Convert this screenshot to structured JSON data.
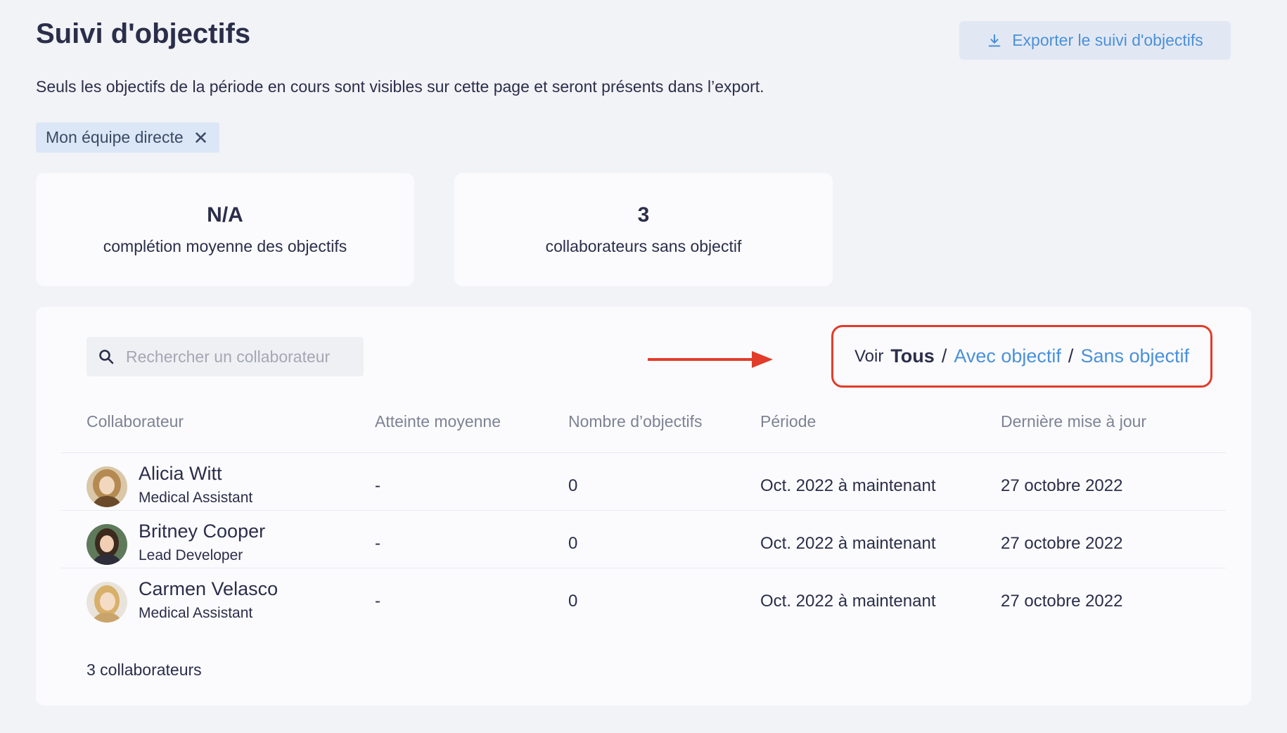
{
  "header": {
    "title": "Suivi d'objectifs",
    "export_label": "Exporter le suivi d'objectifs",
    "subtitle": "Seuls les objectifs de la période en cours sont visibles sur cette page et seront présents dans l’export."
  },
  "filter_chip": {
    "label": "Mon équipe directe",
    "close": "✕"
  },
  "stats": [
    {
      "value": "N/A",
      "label": "complétion moyenne des objectifs"
    },
    {
      "value": "3",
      "label": "collaborateurs sans objectif"
    }
  ],
  "search": {
    "placeholder": "Rechercher un collaborateur"
  },
  "view_toggle": {
    "prefix": "Voir",
    "options": [
      "Tous",
      "Avec objectif",
      "Sans objectif"
    ],
    "separator": "/"
  },
  "table": {
    "columns": [
      "Collaborateur",
      "Atteinte moyenne",
      "Nombre d’objectifs",
      "Période",
      "Dernière mise à jour"
    ],
    "rows": [
      {
        "name": "Alicia Witt",
        "role": "Medical Assistant",
        "atteinte": "-",
        "nombre": "0",
        "periode": "Oct. 2022 à maintenant",
        "maj": "27 octobre 2022"
      },
      {
        "name": "Britney Cooper",
        "role": "Lead Developer",
        "atteinte": "-",
        "nombre": "0",
        "periode": "Oct. 2022 à maintenant",
        "maj": "27 octobre 2022"
      },
      {
        "name": "Carmen Velasco",
        "role": "Medical Assistant",
        "atteinte": "-",
        "nombre": "0",
        "periode": "Oct. 2022 à maintenant",
        "maj": "27 octobre 2022"
      }
    ],
    "footer": "3 collaborateurs"
  },
  "colors": {
    "accent": "#4a90d9",
    "highlight_border": "#e23c2a",
    "background": "#f2f3f7"
  }
}
